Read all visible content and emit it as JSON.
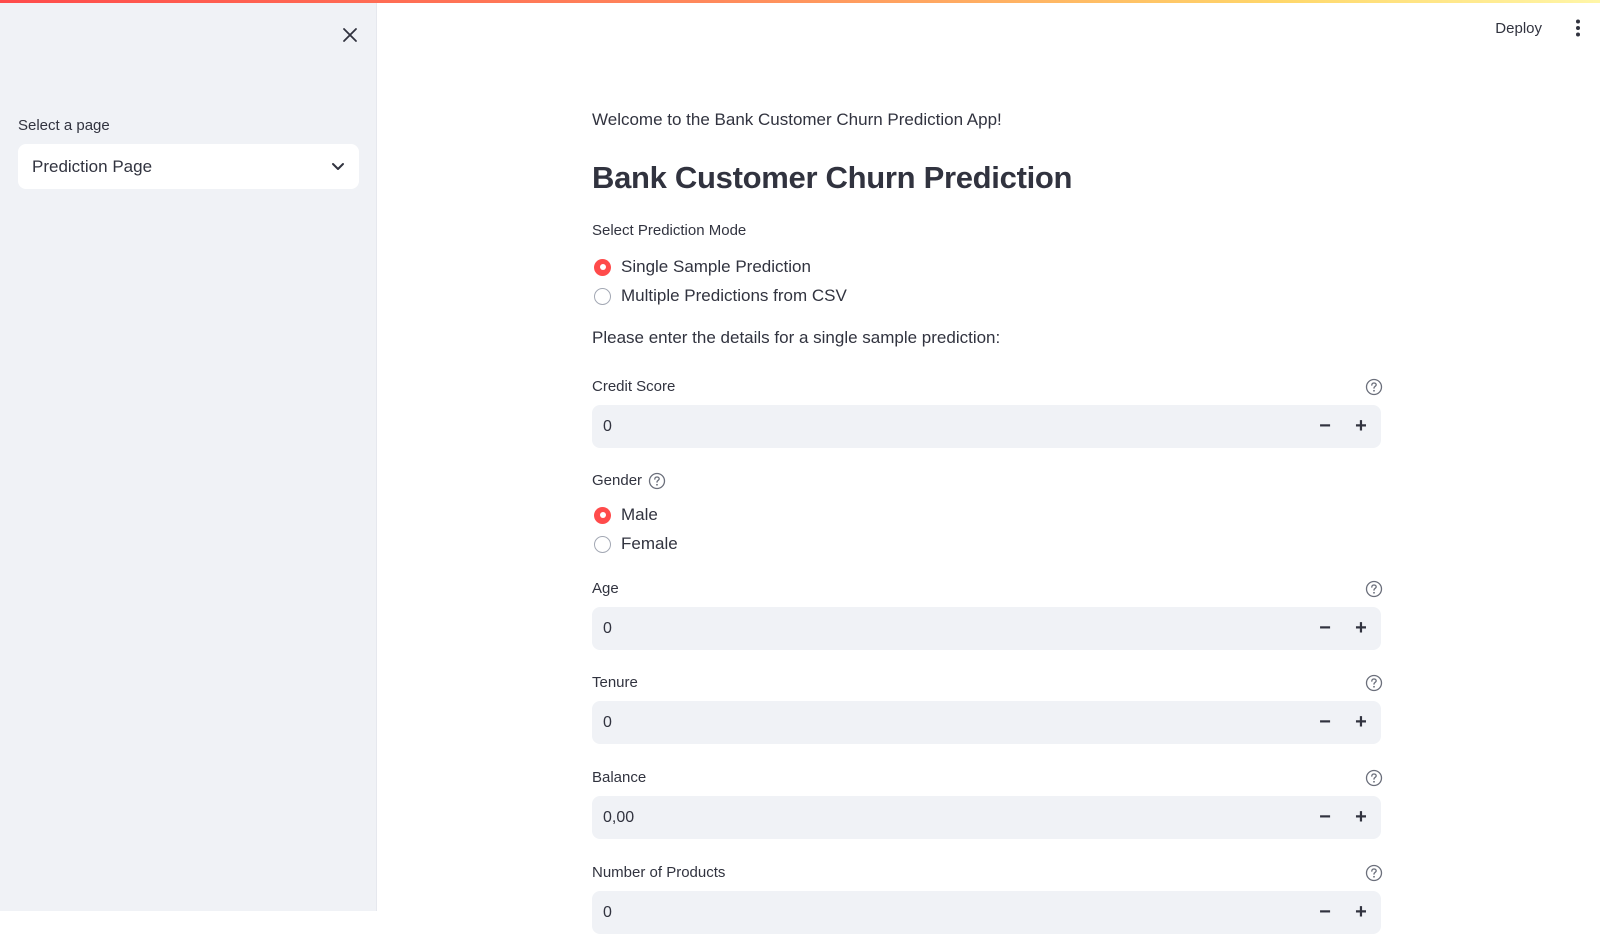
{
  "sidebar": {
    "select_label": "Select a page",
    "selected_page": "Prediction Page"
  },
  "header": {
    "deploy_label": "Deploy"
  },
  "main": {
    "welcome_text": "Welcome to the Bank Customer Churn Prediction App!",
    "title": "Bank Customer Churn Prediction",
    "mode": {
      "label": "Select Prediction Mode",
      "options": [
        "Single Sample Prediction",
        "Multiple Predictions from CSV"
      ],
      "selected": "Single Sample Prediction"
    },
    "instruction": "Please enter the details for a single sample prediction:",
    "credit_score": {
      "label": "Credit Score",
      "value": "0"
    },
    "gender": {
      "label": "Gender",
      "options": [
        "Male",
        "Female"
      ],
      "selected": "Male"
    },
    "age": {
      "label": "Age",
      "value": "0"
    },
    "tenure": {
      "label": "Tenure",
      "value": "0"
    },
    "balance": {
      "label": "Balance",
      "value": "0,00"
    },
    "num_products": {
      "label": "Number of Products",
      "value": "0"
    }
  },
  "colors": {
    "accent": "#ff4b4b",
    "sidebar_bg": "#f0f2f6",
    "input_bg": "#f0f2f6",
    "text": "#31333f"
  }
}
